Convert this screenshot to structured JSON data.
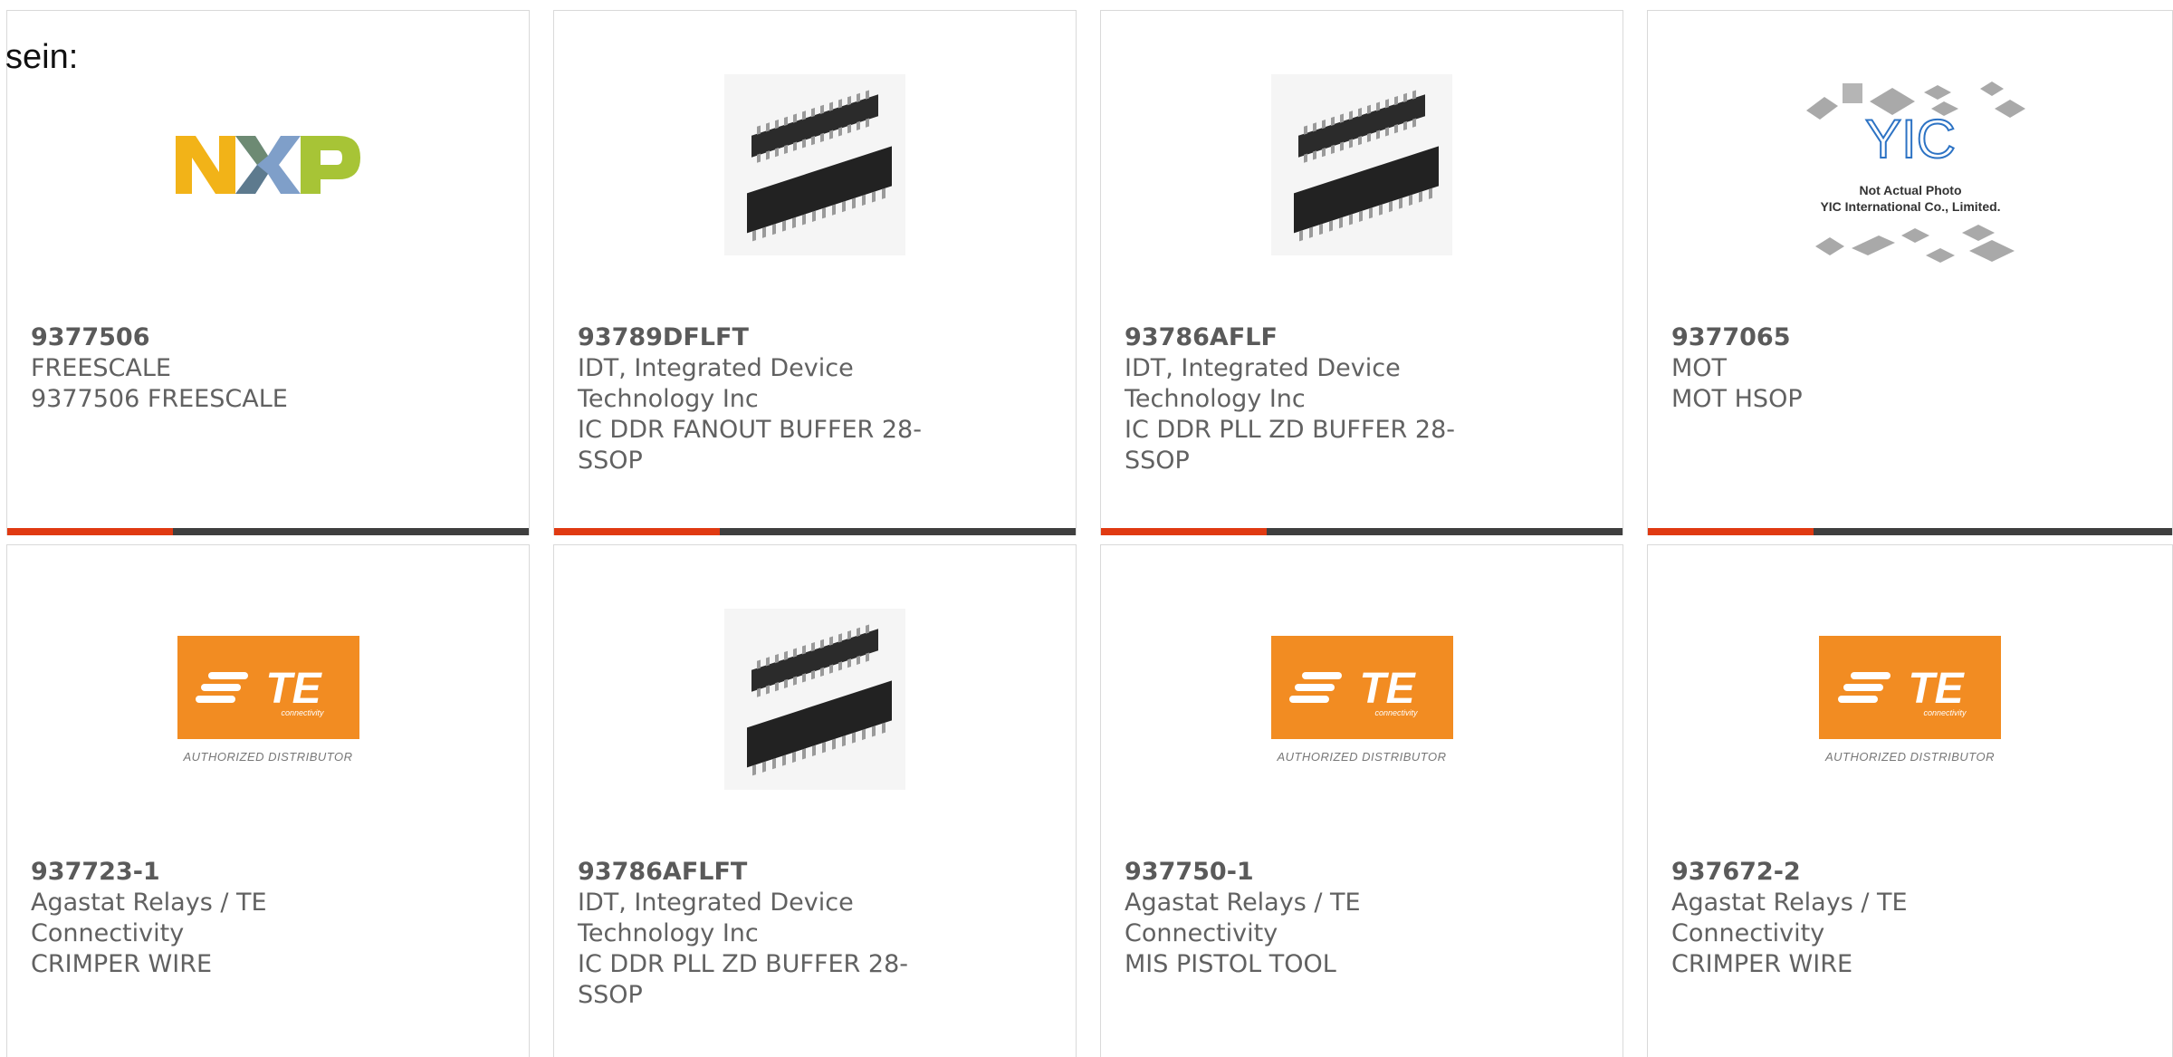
{
  "page_fragment": "sein:",
  "products": [
    {
      "part": "9377506",
      "maker": "FREESCALE",
      "desc": "9377506 FREESCALE",
      "image": "nxp-logo"
    },
    {
      "part": "93789DFLFT",
      "maker": "IDT, Integrated Device Technology Inc",
      "desc": "IC DDR FANOUT BUFFER 28-SSOP",
      "image": "chip-photo"
    },
    {
      "part": "93786AFLF",
      "maker": "IDT, Integrated Device Technology Inc",
      "desc": "IC DDR PLL ZD BUFFER 28-SSOP",
      "image": "chip-photo"
    },
    {
      "part": "9377065",
      "maker": "MOT",
      "desc": "MOT HSOP",
      "image": "yic-placeholder"
    },
    {
      "part": "937723-1",
      "maker": "Agastat Relays / TE Connectivity",
      "desc": "CRIMPER WIRE",
      "image": "te-logo"
    },
    {
      "part": "93786AFLFT",
      "maker": "IDT, Integrated Device Technology Inc",
      "desc": "IC DDR PLL ZD BUFFER 28-SSOP",
      "image": "chip-photo"
    },
    {
      "part": "937750-1",
      "maker": "Agastat Relays / TE Connectivity",
      "desc": "MIS PISTOL TOOL",
      "image": "te-logo"
    },
    {
      "part": "937672-2",
      "maker": "Agastat Relays / TE Connectivity",
      "desc": "CRIMPER WIRE",
      "image": "te-logo"
    }
  ],
  "logos": {
    "te_text": "TE",
    "te_sub": "connectivity",
    "te_caption": "AUTHORIZED DISTRIBUTOR",
    "yic_mark": "YIC",
    "yic_line1": "Not Actual Photo",
    "yic_line2": "YIC International Co., Limited."
  },
  "colors": {
    "accent": "#e03a12",
    "bar": "#3f3f3f",
    "te_orange": "#f28c22"
  }
}
